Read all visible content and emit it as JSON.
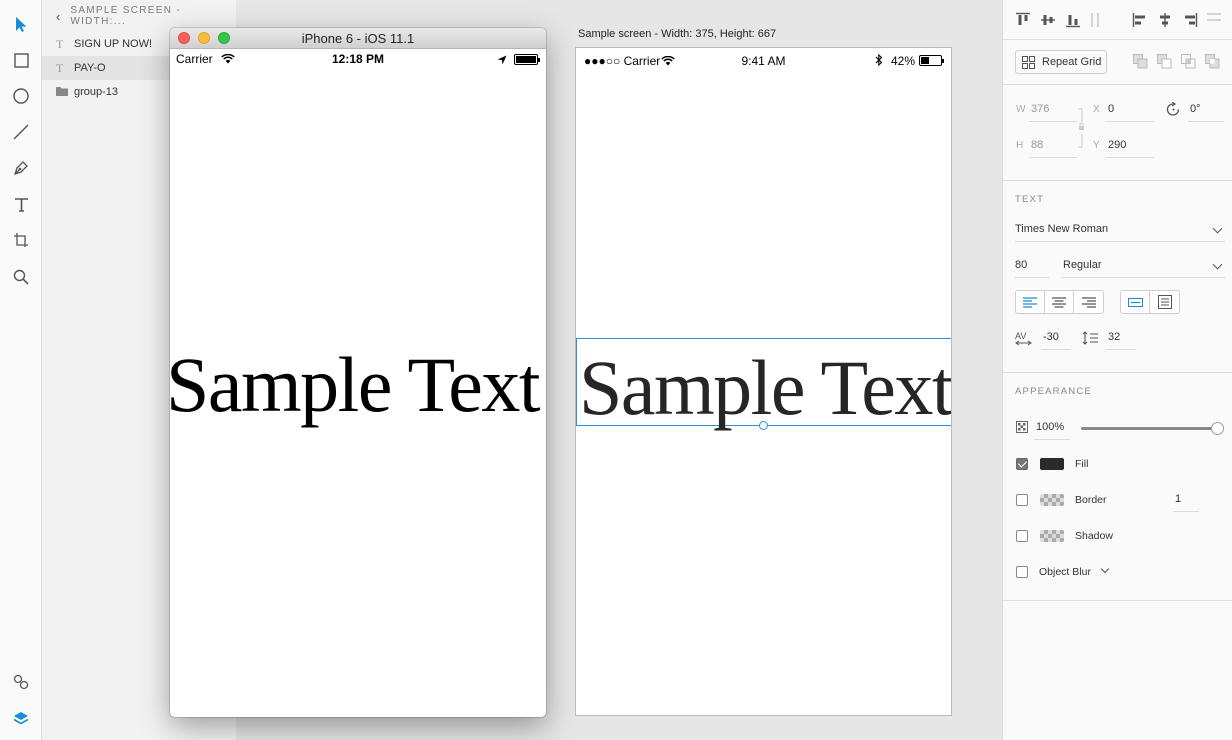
{
  "layers": {
    "breadcrumb": "SAMPLE SCREEN - WIDTH:...",
    "items": [
      {
        "type_glyph": "T",
        "label": "SIGN UP NOW!"
      },
      {
        "type_glyph": "T",
        "label": "PAY-O"
      },
      {
        "type_glyph": "",
        "label": "group-13"
      }
    ]
  },
  "simulator": {
    "title": "iPhone 6 - iOS 11.1",
    "status": {
      "carrier": "Carrier",
      "time": "12:18 PM"
    },
    "sample_text": "Sample Text"
  },
  "artboard": {
    "label": "Sample screen - Width: 375, Height: 667",
    "status": {
      "carrier": "●●●○○ Carrier",
      "time": "9:41 AM",
      "battery": "42%"
    },
    "sample_text": "Sample Text"
  },
  "inspector": {
    "repeat_grid_label": "Repeat Grid",
    "transform": {
      "w_label": "W",
      "w": "376",
      "h_label": "H",
      "h": "88",
      "x_label": "X",
      "x": "0",
      "y_label": "Y",
      "y": "290",
      "rotation": "0°"
    },
    "text": {
      "header": "TEXT",
      "font": "Times New Roman",
      "size": "80",
      "weight": "Regular",
      "char_spacing": "-30",
      "line_spacing": "32"
    },
    "appearance": {
      "header": "APPEARANCE",
      "opacity": "100%",
      "opacity_level": 1.0,
      "fill_label": "Fill",
      "fill_color": "#2a2a2a",
      "fill_checked": true,
      "border_label": "Border",
      "border_width": "1",
      "border_checked": false,
      "shadow_label": "Shadow",
      "shadow_checked": false,
      "blur_label": "Object Blur",
      "blur_checked": false
    }
  },
  "colors": {
    "accent": "#1a8cd8",
    "selection": "#2c8fe0"
  }
}
